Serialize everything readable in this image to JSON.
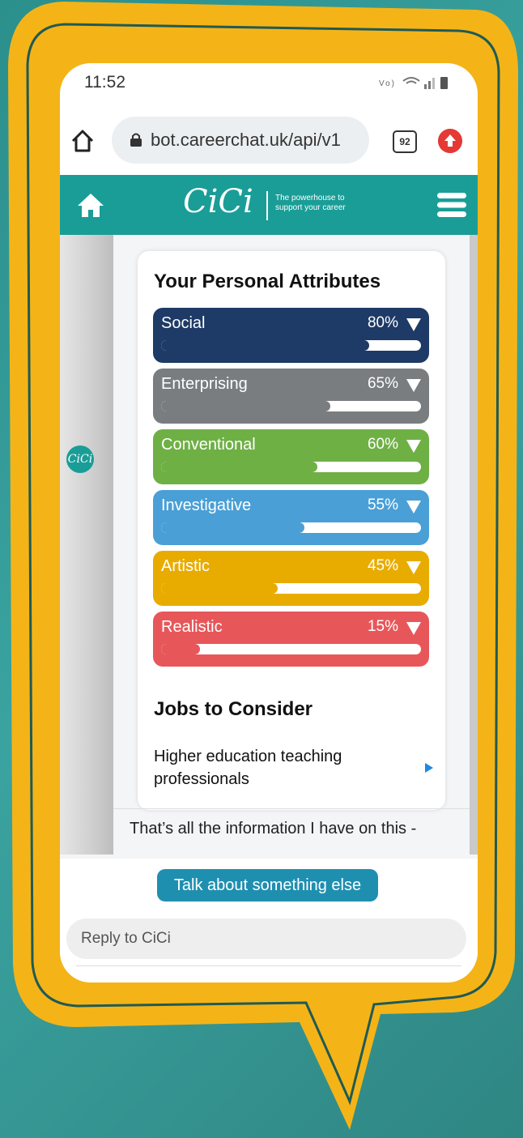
{
  "status_bar": {
    "time": "11:52",
    "icons": [
      "volte-lte-icon",
      "wifi-icon",
      "signal-icon",
      "battery-icon"
    ]
  },
  "browser": {
    "url": "bot.careerchat.uk/api/v1",
    "tab_count": "92"
  },
  "app": {
    "logo": "CiCi",
    "tagline": "The powerhouse to support your career",
    "brand_color": "#1a9d97"
  },
  "avatar_text": "CiCi",
  "attributes": {
    "title": "Your Personal Attributes",
    "items": [
      {
        "name": "Social",
        "percent_label": "80%",
        "value": 80,
        "color": "#1e3a66"
      },
      {
        "name": "Enterprising",
        "percent_label": "65%",
        "value": 65,
        "color": "#7a7d80"
      },
      {
        "name": "Conventional",
        "percent_label": "60%",
        "value": 60,
        "color": "#6fb045"
      },
      {
        "name": "Investigative",
        "percent_label": "55%",
        "value": 55,
        "color": "#4a9fd6"
      },
      {
        "name": "Artistic",
        "percent_label": "45%",
        "value": 45,
        "color": "#e8ac00"
      },
      {
        "name": "Realistic",
        "percent_label": "15%",
        "value": 15,
        "color": "#e7575a"
      }
    ]
  },
  "jobs": {
    "title": "Jobs to Consider",
    "first_job": "Higher education teaching professionals"
  },
  "message": "That’s all the information I have on this -",
  "talk_button": "Talk about something else",
  "reply_placeholder": "Reply to CiCi",
  "frame_color": "#f4b417"
}
